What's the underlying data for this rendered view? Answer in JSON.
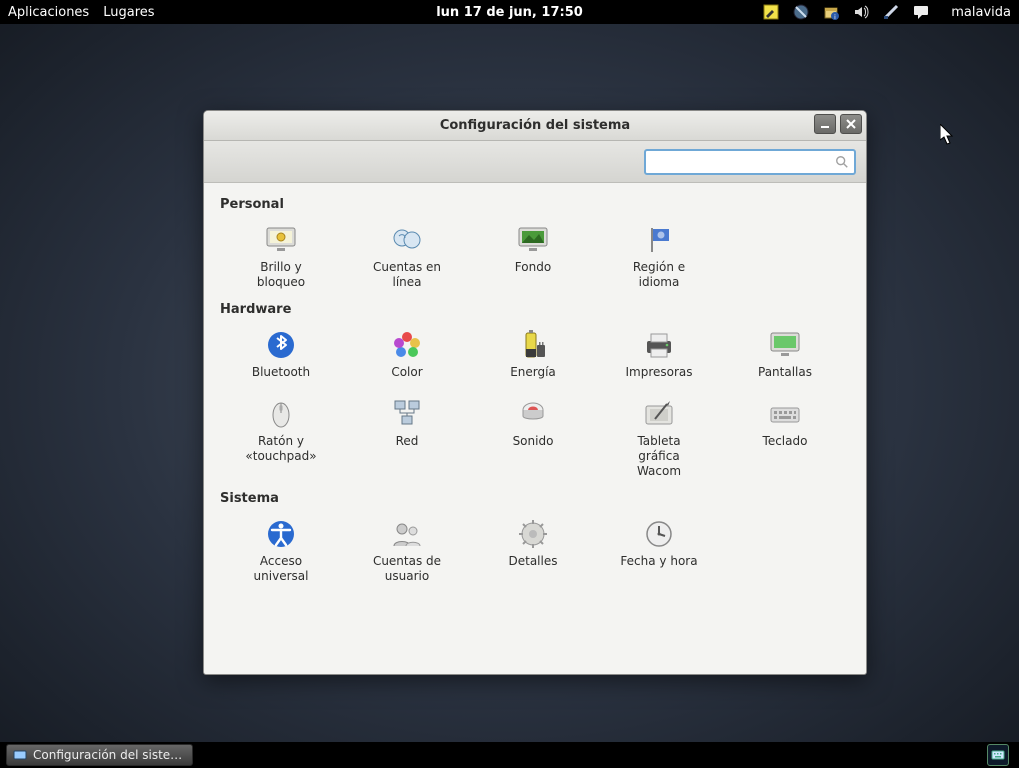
{
  "top_panel": {
    "menu_apps": "Aplicaciones",
    "menu_places": "Lugares",
    "clock": "lun 17 de jun, 17:50",
    "user": "malavida"
  },
  "window": {
    "title": "Configuración del sistema",
    "search_placeholder": ""
  },
  "sections": {
    "personal": "Personal",
    "hardware": "Hardware",
    "sistema": "Sistema"
  },
  "items": {
    "brillo": "Brillo y\nbloqueo",
    "cuentas_linea": "Cuentas en\nlínea",
    "fondo": "Fondo",
    "region": "Región e\nidioma",
    "bluetooth": "Bluetooth",
    "color": "Color",
    "energia": "Energía",
    "impresoras": "Impresoras",
    "pantallas": "Pantallas",
    "raton": "Ratón y\n«touchpad»",
    "red": "Red",
    "sonido": "Sonido",
    "tableta": "Tableta\ngráfica\nWacom",
    "teclado": "Teclado",
    "acceso": "Acceso\nuniversal",
    "cuentas_usuario": "Cuentas de\nusuario",
    "detalles": "Detalles",
    "fechahora": "Fecha y hora"
  },
  "taskbar": {
    "button": "Configuración del siste…"
  }
}
